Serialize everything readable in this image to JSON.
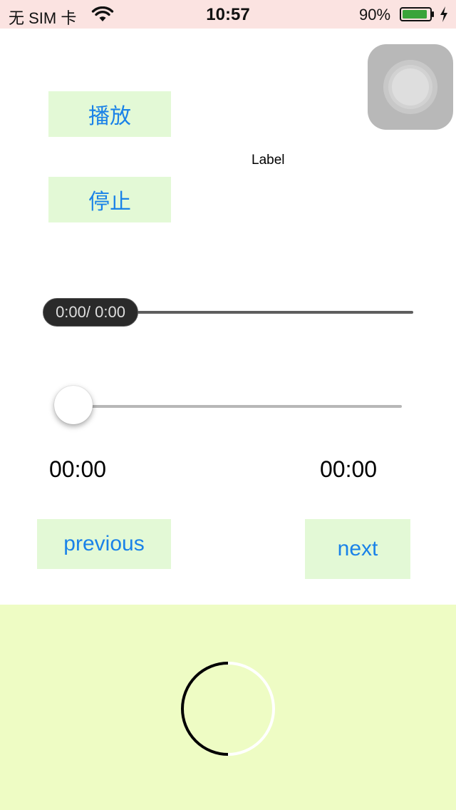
{
  "status_bar": {
    "carrier": "无 SIM 卡",
    "time": "10:57",
    "battery_percent": "90%",
    "battery_level": 0.9,
    "icons": [
      "wifi-icon",
      "battery-icon",
      "charging-bolt-icon"
    ]
  },
  "buttons": {
    "play": "播放",
    "stop": "停止",
    "previous": "previous",
    "next": "next"
  },
  "label": "Label",
  "progress": {
    "text": "0:00/ 0:00",
    "value": 0
  },
  "slider": {
    "value": 0,
    "current_time": "00:00",
    "total_time": "00:00"
  },
  "spinner": {
    "icon": "loading-spinner-icon"
  },
  "colors": {
    "button_bg": "#e3f9d6",
    "button_text": "#1a82e8",
    "status_bar_bg": "#fbe3e1",
    "bottom_panel_bg": "#eefcc4"
  }
}
